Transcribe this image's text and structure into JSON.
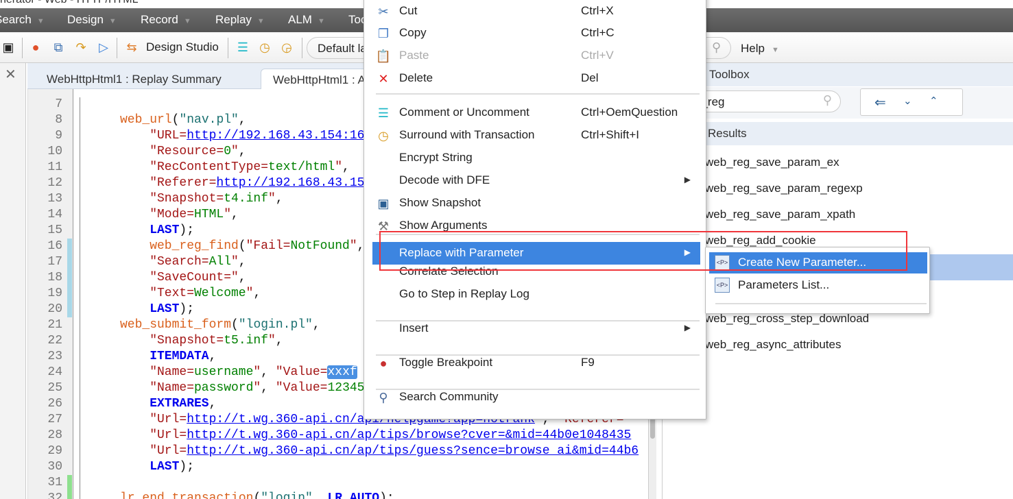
{
  "window": {
    "title": "nerator - Web - HTTP/HTML"
  },
  "menubar": [
    {
      "label": "Search"
    },
    {
      "label": "Design"
    },
    {
      "label": "Record"
    },
    {
      "label": "Replay"
    },
    {
      "label": "ALM"
    },
    {
      "label": "Too"
    },
    {
      "label": "Help"
    }
  ],
  "toolbar": {
    "design_studio": "Design Studio",
    "layout_select": "Default la"
  },
  "tabs": [
    {
      "label": "WebHttpHtml1 : Replay Summary"
    },
    {
      "label": "WebHttpHtml1 : A"
    }
  ],
  "editor": {
    "lines": [
      {
        "n": "7",
        "mark": "",
        "tokens": []
      },
      {
        "n": "8",
        "mark": "",
        "indent": 5,
        "tokens": [
          [
            "fn",
            "web_url"
          ],
          [
            "p",
            "("
          ],
          [
            "tl",
            "\"nav.pl\""
          ],
          [
            "p",
            ","
          ]
        ]
      },
      {
        "n": "9",
        "mark": "",
        "indent": 9,
        "tokens": [
          [
            "str",
            "\"URL="
          ],
          [
            "url",
            "http://192.168.43.154:16"
          ]
        ]
      },
      {
        "n": "10",
        "mark": "",
        "indent": 9,
        "tokens": [
          [
            "str",
            "\"Resource="
          ],
          [
            "val",
            "0"
          ],
          [
            "str",
            "\""
          ],
          [
            "p",
            ","
          ]
        ]
      },
      {
        "n": "11",
        "mark": "",
        "indent": 9,
        "tokens": [
          [
            "str",
            "\"RecContentType="
          ],
          [
            "val",
            "text/html"
          ],
          [
            "str",
            "\""
          ],
          [
            "p",
            ","
          ]
        ]
      },
      {
        "n": "12",
        "mark": "",
        "indent": 9,
        "tokens": [
          [
            "str",
            "\"Referer="
          ],
          [
            "url",
            "http://192.168.43.15"
          ]
        ]
      },
      {
        "n": "13",
        "mark": "",
        "indent": 9,
        "tokens": [
          [
            "str",
            "\"Snapshot="
          ],
          [
            "val",
            "t4.inf"
          ],
          [
            "str",
            "\""
          ],
          [
            "p",
            ","
          ]
        ]
      },
      {
        "n": "14",
        "mark": "",
        "indent": 9,
        "tokens": [
          [
            "str",
            "\"Mode="
          ],
          [
            "val",
            "HTML"
          ],
          [
            "str",
            "\""
          ],
          [
            "p",
            ","
          ]
        ]
      },
      {
        "n": "15",
        "mark": "",
        "indent": 9,
        "tokens": [
          [
            "kw",
            "LAST"
          ],
          [
            "p",
            ");"
          ]
        ]
      },
      {
        "n": "16",
        "mark": "blue",
        "indent": 9,
        "tokens": [
          [
            "fn",
            "web_reg_find"
          ],
          [
            "p",
            "("
          ],
          [
            "str",
            "\"Fail="
          ],
          [
            "val",
            "NotFound"
          ],
          [
            "str",
            "\""
          ],
          [
            "p",
            ","
          ]
        ]
      },
      {
        "n": "17",
        "mark": "blue",
        "indent": 9,
        "tokens": [
          [
            "str",
            "\"Search="
          ],
          [
            "val",
            "All"
          ],
          [
            "str",
            "\""
          ],
          [
            "p",
            ","
          ]
        ]
      },
      {
        "n": "18",
        "mark": "blue",
        "indent": 9,
        "tokens": [
          [
            "str",
            "\"SaveCount=\""
          ],
          [
            "p",
            ","
          ]
        ]
      },
      {
        "n": "19",
        "mark": "blue",
        "indent": 9,
        "tokens": [
          [
            "str",
            "\"Text="
          ],
          [
            "val",
            "Welcome"
          ],
          [
            "str",
            "\""
          ],
          [
            "p",
            ","
          ]
        ]
      },
      {
        "n": "20",
        "mark": "blue",
        "indent": 9,
        "tokens": [
          [
            "kw",
            "LAST"
          ],
          [
            "p",
            ");"
          ]
        ]
      },
      {
        "n": "21",
        "mark": "",
        "indent": 5,
        "tokens": [
          [
            "fn",
            "web_submit_form"
          ],
          [
            "p",
            "("
          ],
          [
            "tl",
            "\"login.pl\""
          ],
          [
            "p",
            ","
          ]
        ]
      },
      {
        "n": "22",
        "mark": "",
        "indent": 9,
        "tokens": [
          [
            "str",
            "\"Snapshot="
          ],
          [
            "val",
            "t5.inf"
          ],
          [
            "str",
            "\""
          ],
          [
            "p",
            ","
          ]
        ]
      },
      {
        "n": "23",
        "mark": "",
        "indent": 9,
        "tokens": [
          [
            "kw",
            "ITEMDATA"
          ],
          [
            "p",
            ","
          ]
        ]
      },
      {
        "n": "24",
        "mark": "",
        "indent": 9,
        "tokens": [
          [
            "str",
            "\"Name="
          ],
          [
            "val",
            "username"
          ],
          [
            "str",
            "\""
          ],
          [
            "p",
            ", "
          ],
          [
            "str",
            "\"Value="
          ],
          [
            "sel",
            "xxxf"
          ]
        ]
      },
      {
        "n": "25",
        "mark": "",
        "indent": 9,
        "tokens": [
          [
            "str",
            "\"Name="
          ],
          [
            "val",
            "password"
          ],
          [
            "str",
            "\""
          ],
          [
            "p",
            ", "
          ],
          [
            "str",
            "\"Value="
          ],
          [
            "val",
            "12345"
          ]
        ]
      },
      {
        "n": "26",
        "mark": "",
        "indent": 9,
        "tokens": [
          [
            "kw",
            "EXTRARES"
          ],
          [
            "p",
            ","
          ]
        ]
      },
      {
        "n": "27",
        "mark": "",
        "indent": 9,
        "tokens": [
          [
            "str",
            "\"Url="
          ],
          [
            "url",
            "http://t.wg.360-api.cn/api/helpgame?app=hotrank"
          ],
          [
            "str",
            "\""
          ],
          [
            "p",
            ", "
          ],
          [
            "str",
            "\"Referer="
          ]
        ]
      },
      {
        "n": "28",
        "mark": "",
        "indent": 9,
        "tokens": [
          [
            "str",
            "\"Url="
          ],
          [
            "url",
            "http://t.wg.360-api.cn/ap/tips/browse?cver=&mid=44b0e1048435"
          ]
        ]
      },
      {
        "n": "29",
        "mark": "",
        "indent": 9,
        "tokens": [
          [
            "str",
            "\"Url="
          ],
          [
            "url",
            "http://t.wg.360-api.cn/ap/tips/guess?sence=browse_ai&mid=44b6"
          ]
        ]
      },
      {
        "n": "30",
        "mark": "",
        "indent": 9,
        "tokens": [
          [
            "kw",
            "LAST"
          ],
          [
            "p",
            ");"
          ]
        ]
      },
      {
        "n": "31",
        "mark": "green",
        "tokens": []
      },
      {
        "n": "32",
        "mark": "green",
        "indent": 5,
        "tokens": [
          [
            "fn",
            "lr_end_transaction"
          ],
          [
            "p",
            "("
          ],
          [
            "tl",
            "\"login\""
          ],
          [
            "p",
            ", "
          ],
          [
            "kw",
            "LR_AUTO"
          ],
          [
            "p",
            ");"
          ]
        ]
      }
    ]
  },
  "toolbox": {
    "title": "Toolbox",
    "search_value": "b_reg",
    "results_title": "Results",
    "results": [
      "web_reg_save_param_ex",
      "web_reg_save_param_regexp",
      "web_reg_save_param_xpath",
      "web_reg_add_cookie",
      "",
      "",
      "web_reg_cross_step_download",
      "web_reg_async_attributes"
    ]
  },
  "context_menu": {
    "items": [
      {
        "label": "Cut",
        "shortcut": "Ctrl+X",
        "icon": "scissors-icon"
      },
      {
        "label": "Copy",
        "shortcut": "Ctrl+C",
        "icon": "copy-icon"
      },
      {
        "label": "Paste",
        "shortcut": "Ctrl+V",
        "icon": "paste-icon",
        "disabled": true
      },
      {
        "label": "Delete",
        "shortcut": "Del",
        "icon": "delete-icon"
      },
      {
        "label": "Comment or Uncomment",
        "shortcut": "Ctrl+OemQuestion",
        "icon": "comment-icon"
      },
      {
        "label": "Surround with Transaction",
        "shortcut": "Ctrl+Shift+I",
        "icon": "transaction-icon"
      },
      {
        "label": "Encrypt String",
        "shortcut": ""
      },
      {
        "label": "Decode with DFE",
        "shortcut": "",
        "submenu": true
      },
      {
        "label": "Show Snapshot",
        "shortcut": "",
        "icon": "snapshot-icon"
      },
      {
        "label": "Show Arguments",
        "shortcut": "",
        "icon": "arguments-icon"
      },
      {
        "label": "Replace with Parameter",
        "shortcut": "",
        "submenu": true,
        "highlighted": true
      },
      {
        "label": "Correlate Selection",
        "shortcut": ""
      },
      {
        "label": "Go to Step in Replay Log",
        "shortcut": ""
      },
      {
        "label": "Insert",
        "shortcut": "",
        "submenu": true
      },
      {
        "label": "Toggle Breakpoint",
        "shortcut": "F9",
        "icon": "breakpoint-icon"
      },
      {
        "label": "Search Community",
        "shortcut": "",
        "icon": "community-icon"
      }
    ]
  },
  "submenu": {
    "items": [
      {
        "label": "Create New Parameter...",
        "highlighted": true
      },
      {
        "label": "Parameters List..."
      }
    ]
  },
  "colors": {
    "highlight": "#3d85e0",
    "annotation": "#f0353a",
    "selected_row": "#aec8ee"
  }
}
